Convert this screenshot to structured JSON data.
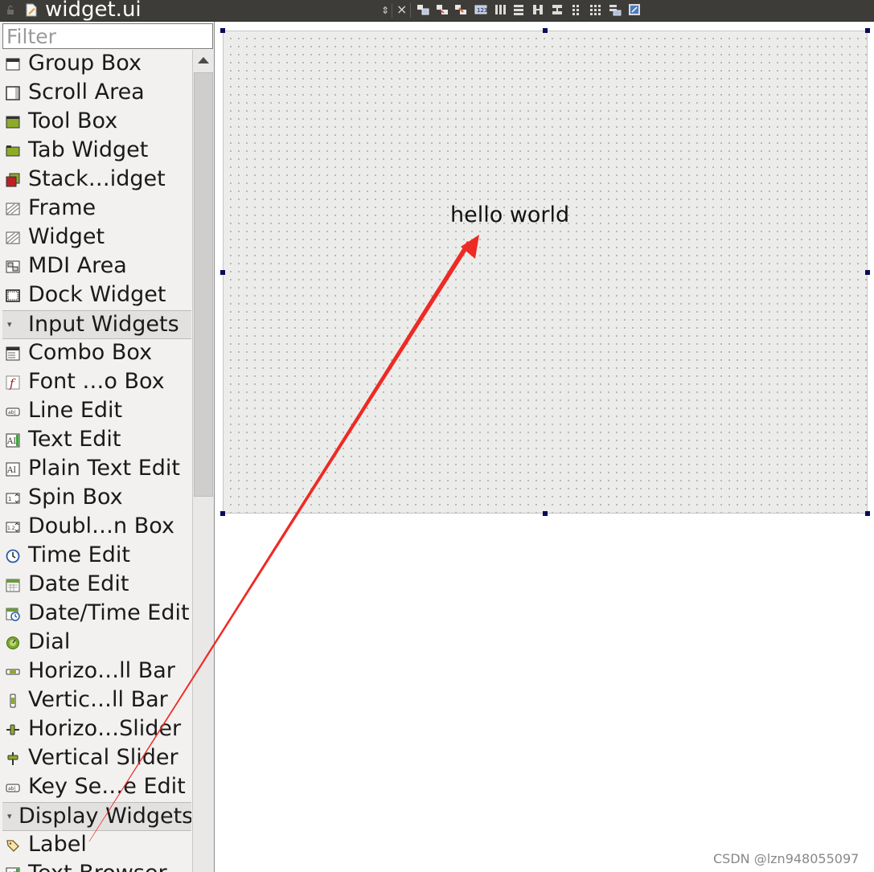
{
  "window": {
    "title": "widget.ui"
  },
  "toolbar": {
    "updown": "⇕",
    "close": "×",
    "icons": [
      "edit-widgets-icon",
      "edit-signals-icon",
      "edit-buddies-icon",
      "edit-tab-order-icon",
      "layout-horizontal-icon",
      "layout-vertical-icon",
      "layout-h-splitter-icon",
      "layout-v-splitter-icon",
      "layout-form-icon",
      "layout-grid-icon",
      "break-layout-icon",
      "adjust-size-icon"
    ]
  },
  "filter": {
    "placeholder": "Filter"
  },
  "widget_list": [
    {
      "type": "item",
      "label": "Group Box",
      "icon": "group-box-icon"
    },
    {
      "type": "item",
      "label": "Scroll Area",
      "icon": "scroll-area-icon"
    },
    {
      "type": "item",
      "label": "Tool Box",
      "icon": "tool-box-icon"
    },
    {
      "type": "item",
      "label": "Tab Widget",
      "icon": "tab-widget-icon"
    },
    {
      "type": "item",
      "label": "Stack…idget",
      "icon": "stacked-widget-icon"
    },
    {
      "type": "item",
      "label": "Frame",
      "icon": "frame-icon"
    },
    {
      "type": "item",
      "label": "Widget",
      "icon": "widget-icon"
    },
    {
      "type": "item",
      "label": "MDI Area",
      "icon": "mdi-area-icon"
    },
    {
      "type": "item",
      "label": "Dock Widget",
      "icon": "dock-widget-icon"
    },
    {
      "type": "category",
      "label": "Input Widgets"
    },
    {
      "type": "item",
      "label": "Combo Box",
      "icon": "combo-box-icon"
    },
    {
      "type": "item",
      "label": "Font …o Box",
      "icon": "font-combo-box-icon"
    },
    {
      "type": "item",
      "label": "Line Edit",
      "icon": "line-edit-icon"
    },
    {
      "type": "item",
      "label": "Text Edit",
      "icon": "text-edit-icon"
    },
    {
      "type": "item",
      "label": "Plain Text Edit",
      "icon": "plain-text-edit-icon"
    },
    {
      "type": "item",
      "label": "Spin Box",
      "icon": "spin-box-icon"
    },
    {
      "type": "item",
      "label": "Doubl…n Box",
      "icon": "double-spin-box-icon"
    },
    {
      "type": "item",
      "label": "Time Edit",
      "icon": "time-edit-icon"
    },
    {
      "type": "item",
      "label": "Date Edit",
      "icon": "date-edit-icon"
    },
    {
      "type": "item",
      "label": "Date/Time Edit",
      "icon": "date-time-edit-icon"
    },
    {
      "type": "item",
      "label": "Dial",
      "icon": "dial-icon"
    },
    {
      "type": "item",
      "label": "Horizo…ll Bar",
      "icon": "horizontal-scroll-bar-icon"
    },
    {
      "type": "item",
      "label": "Vertic…ll Bar",
      "icon": "vertical-scroll-bar-icon"
    },
    {
      "type": "item",
      "label": "Horizo…Slider",
      "icon": "horizontal-slider-icon"
    },
    {
      "type": "item",
      "label": "Vertical Slider",
      "icon": "vertical-slider-icon"
    },
    {
      "type": "item",
      "label": "Key Se…e Edit",
      "icon": "key-sequence-edit-icon"
    },
    {
      "type": "category",
      "label": "Display Widgets"
    },
    {
      "type": "item",
      "label": "Label",
      "icon": "label-icon"
    },
    {
      "type": "item",
      "label": "Text Browser",
      "icon": "text-browser-icon"
    }
  ],
  "form": {
    "label_text": "hello world"
  },
  "annotation": {
    "arrow_color": "#ee2a24"
  },
  "watermark": "CSDN @lzn948055097"
}
